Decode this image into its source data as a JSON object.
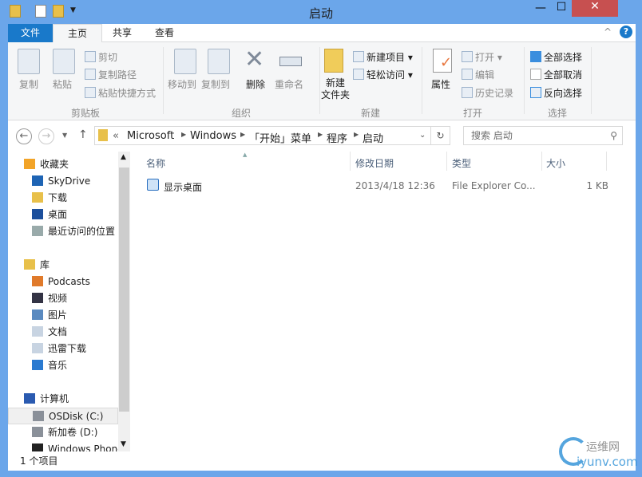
{
  "window": {
    "title": "启动",
    "controls": {
      "minimize": "—",
      "maximize": "☐",
      "close": "✕"
    }
  },
  "quick_access": {
    "icons": [
      "folder-icon",
      "properties-icon",
      "new-folder-icon",
      "customize-dropdown-icon"
    ]
  },
  "tabs": [
    {
      "label": "文件"
    },
    {
      "label": "主页"
    },
    {
      "label": "共享"
    },
    {
      "label": "查看"
    }
  ],
  "ribbon": {
    "clipboard": {
      "copy": "复制",
      "paste": "粘贴",
      "cut": "剪切",
      "copy_path": "复制路径",
      "paste_shortcut": "粘贴快捷方式",
      "group": "剪贴板"
    },
    "organize": {
      "move_to": "移动到",
      "copy_to": "复制到",
      "delete": "删除",
      "rename": "重命名",
      "group": "组织"
    },
    "new": {
      "new_folder_line1": "新建",
      "new_folder_line2": "文件夹",
      "new_item": "新建项目 ▾",
      "easy_access": "轻松访问 ▾",
      "group": "新建"
    },
    "open": {
      "properties": "属性",
      "open": "打开 ▾",
      "edit": "编辑",
      "history": "历史记录",
      "group": "打开"
    },
    "select": {
      "select_all": "全部选择",
      "select_none": "全部取消",
      "invert": "反向选择",
      "group": "选择"
    }
  },
  "address": {
    "path": [
      "«",
      "Microsoft",
      "Windows",
      "「开始」菜单",
      "程序",
      "启动"
    ],
    "search_placeholder": "搜索 启动"
  },
  "nav_pane": [
    {
      "label": "收藏夹",
      "icon": "star-icon",
      "level": 0
    },
    {
      "label": "SkyDrive",
      "icon": "skydrive-icon",
      "level": 1
    },
    {
      "label": "下载",
      "icon": "download-folder-icon",
      "level": 1
    },
    {
      "label": "桌面",
      "icon": "desktop-icon",
      "level": 1
    },
    {
      "label": "最近访问的位置",
      "icon": "recent-places-icon",
      "level": 1
    },
    {
      "label": "库",
      "icon": "library-icon",
      "level": 0
    },
    {
      "label": "Podcasts",
      "icon": "podcast-icon",
      "level": 1
    },
    {
      "label": "视频",
      "icon": "video-icon",
      "level": 1
    },
    {
      "label": "图片",
      "icon": "pictures-icon",
      "level": 1
    },
    {
      "label": "文档",
      "icon": "documents-icon",
      "level": 1
    },
    {
      "label": "迅雷下载",
      "icon": "documents-icon",
      "level": 1
    },
    {
      "label": "音乐",
      "icon": "music-icon",
      "level": 1
    },
    {
      "label": "计算机",
      "icon": "computer-icon",
      "level": 0
    },
    {
      "label": "OSDisk (C:)",
      "icon": "drive-icon",
      "level": 1,
      "selected": true
    },
    {
      "label": "新加卷 (D:)",
      "icon": "drive-icon",
      "level": 1
    },
    {
      "label": "Windows Phone",
      "icon": "phone-icon",
      "level": 1
    }
  ],
  "columns": {
    "name": "名称",
    "date": "修改日期",
    "type": "类型",
    "size": "大小"
  },
  "files": [
    {
      "name": "显示桌面",
      "date": "2013/4/18 12:36",
      "type": "File Explorer Co...",
      "size": "1 KB"
    }
  ],
  "status": {
    "count": "1 个项目"
  },
  "watermark": {
    "text1": "运维网",
    "text2": "iyunv.com"
  },
  "colors": {
    "accent": "#1979ca",
    "titlebar": "#6ba6ea",
    "close": "#c75050"
  }
}
